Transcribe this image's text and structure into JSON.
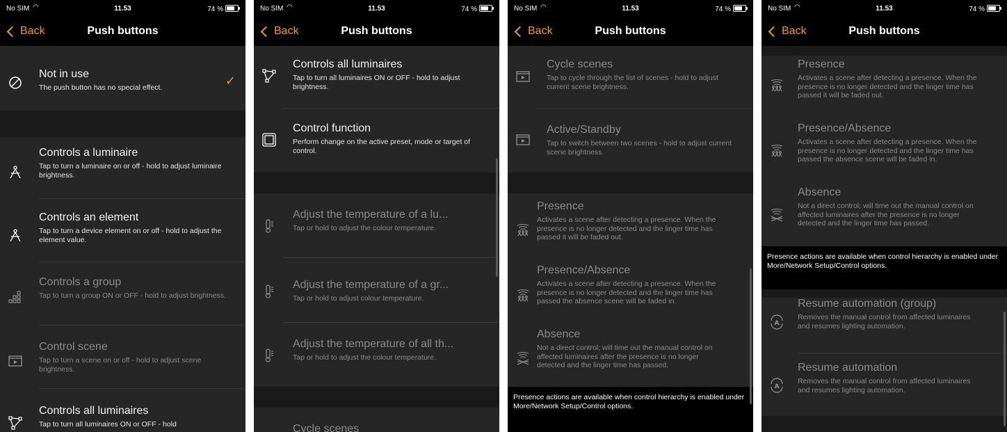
{
  "status": {
    "carrier": "No SIM",
    "time": "11.53",
    "battery": "74 %"
  },
  "nav": {
    "back_label": "Back",
    "title": "Push buttons"
  },
  "accent_color": "#f39c12",
  "texts": {
    "not_in_use": {
      "title": "Not in use",
      "desc": "The push button has no special effect."
    },
    "controls_luminaire": {
      "title": "Controls a luminaire",
      "desc": "Tap to turn a luminaire on or off - hold to adjust luminaire brightness."
    },
    "controls_element": {
      "title": "Controls an element",
      "desc": "Tap to turn a device element on or off - hold to adjust the element value."
    },
    "controls_group": {
      "title": "Controls a group",
      "desc": "Tap to turn a group ON or OFF - hold to adjust brightness."
    },
    "control_scene": {
      "title": "Control scene",
      "desc": "Tap to turn a scene on or off - hold to adjust scene brightness."
    },
    "controls_all": {
      "title": "Controls all luminaires",
      "desc": "Tap to turn all luminaires ON or OFF - hold to adjust brightness.",
      "desc_cut": "Tap to turn all luminaires ON or OFF - hold"
    },
    "control_function": {
      "title": "Control function",
      "desc": "Perform change on the active preset, mode or target of control."
    },
    "adjust_temp_lu": {
      "title": "Adjust the temperature of a lu...",
      "desc": "Tap or hold to adjust the colour temperature."
    },
    "adjust_temp_gr": {
      "title": "Adjust the temperature of a gr...",
      "desc": "Tap or hold to adjust colour temperature."
    },
    "adjust_temp_all": {
      "title": "Adjust the temperature of all th...",
      "desc": "Tap or hold to adjust the colour temperature."
    },
    "cycle_scenes": {
      "title": "Cycle scenes",
      "desc": "Tap to cycle through the list of scenes - hold to adjust current scene brightness."
    },
    "active_standby": {
      "title": "Active/Standby",
      "desc": "Tap to switch between two scenes - hold to adjust current scene brightness."
    },
    "presence": {
      "title": "Presence",
      "desc": "Activates a scene after detecting a presence. When the presence is no longer detected and the linger time has passed it will be faded out."
    },
    "presence_absence": {
      "title": "Presence/Absence",
      "desc": "Activates a scene after detecting a presence. When the presence is no longer detected and the linger time has passed the absence scene will be faded in."
    },
    "absence": {
      "title": "Absence",
      "desc": "Not a direct control; will time out the manual control on affected luminaires after the presence is no longer detected and the linger time has passed."
    },
    "presence_note": "Presence actions are available when control hierarchy is enabled under More/Network Setup/Control options.",
    "resume_group": {
      "title": "Resume automation (group)",
      "desc": "Removes the manual control from affected luminaires and resumes lighting automation."
    },
    "resume": {
      "title": "Resume automation",
      "desc": "Removes the manual control from affected luminaires and resumes lighting automation."
    }
  }
}
